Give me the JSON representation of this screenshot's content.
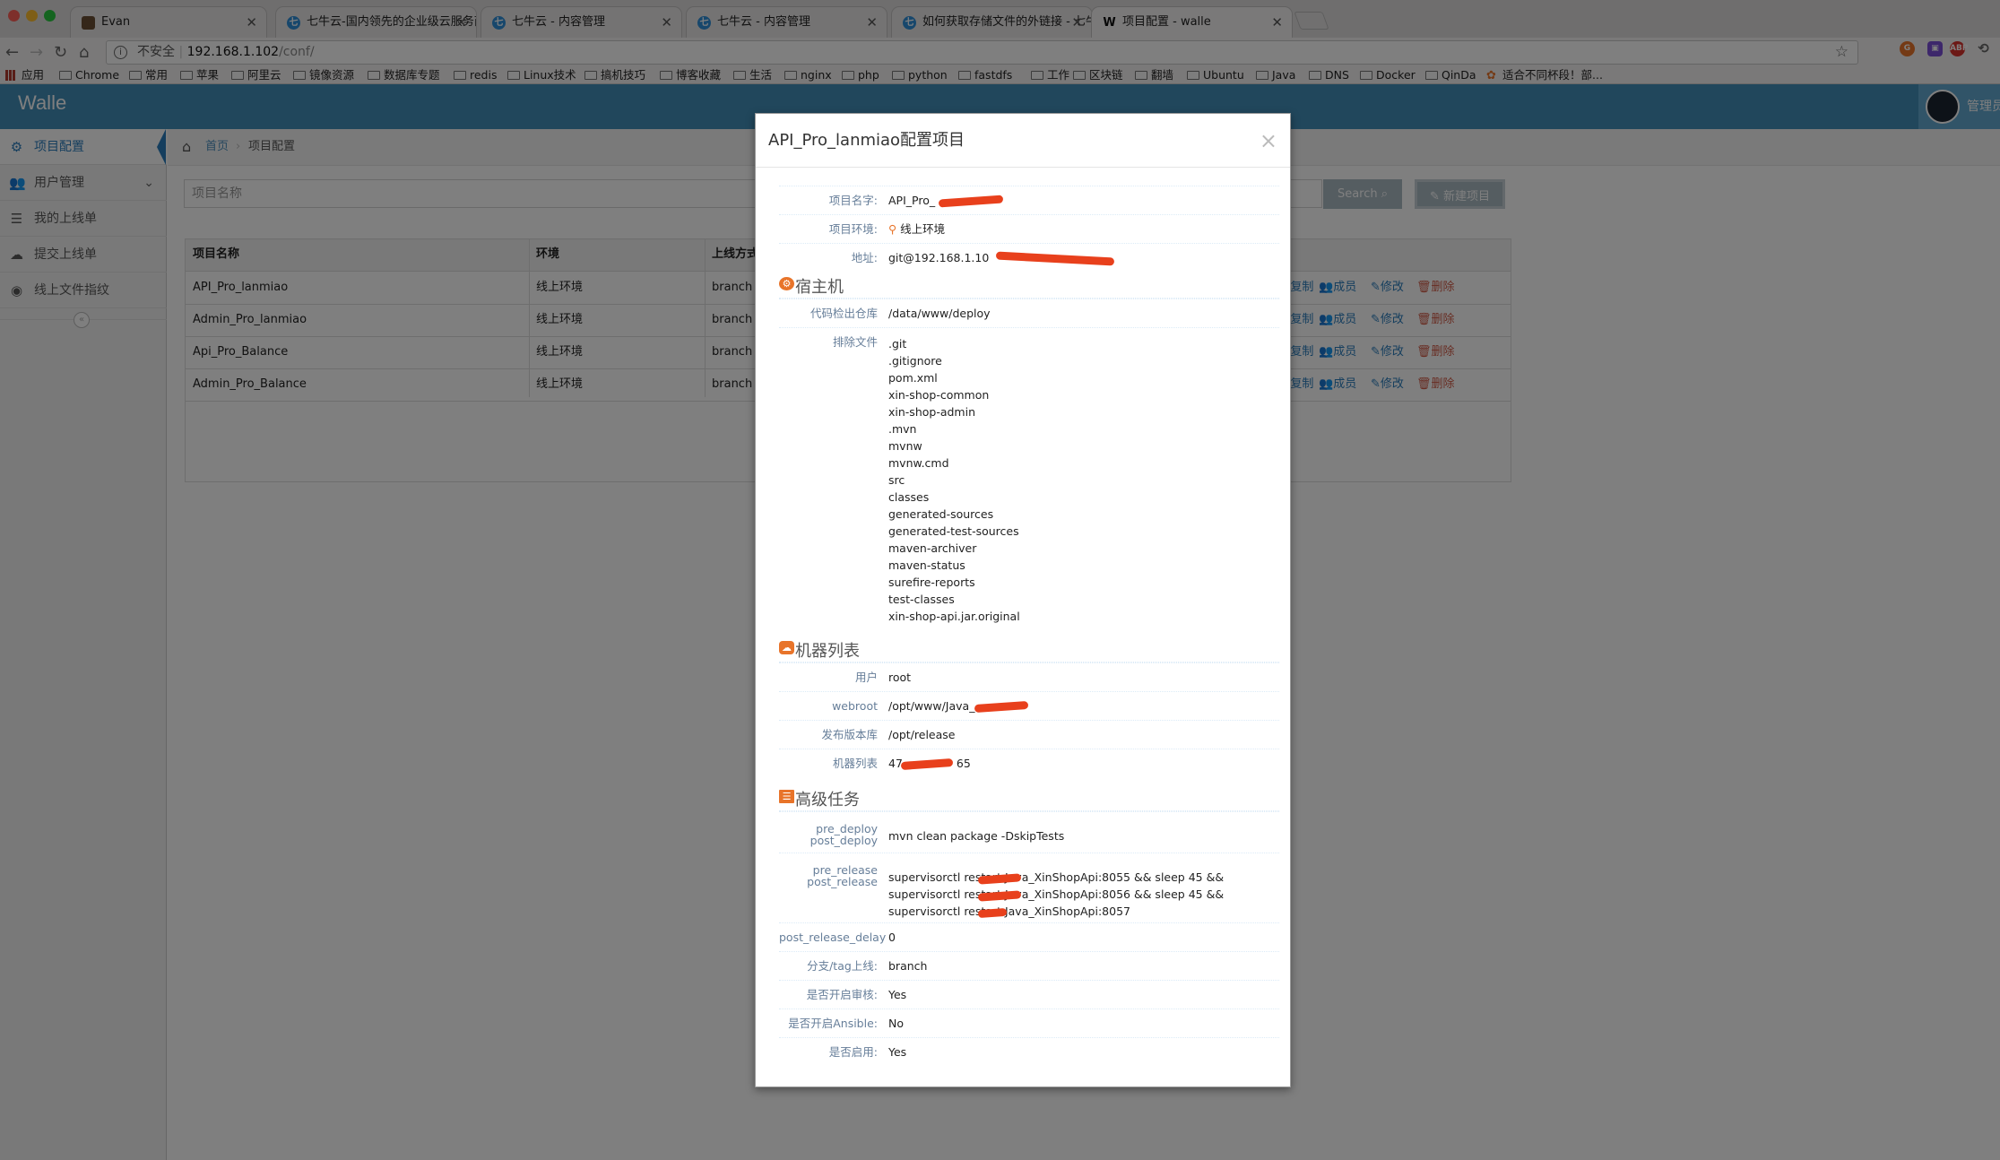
{
  "browser": {
    "tabs": [
      {
        "label": "Evan"
      },
      {
        "label": "七牛云-国内领先的企业级云服务商"
      },
      {
        "label": "七牛云 - 内容管理"
      },
      {
        "label": "七牛云 - 内容管理"
      },
      {
        "label": "如何获取存储文件的外链接 - 七牛"
      },
      {
        "label": "项目配置 - walle"
      }
    ],
    "url": {
      "security": "不安全",
      "host": "192.168.1.102",
      "path": "/conf/"
    },
    "bookmarks": [
      "应用",
      "Chrome",
      "常用",
      "苹果",
      "阿里云",
      "镜像资源",
      "数据库专题",
      "redis",
      "Linux技术",
      "搞机技巧",
      "博客收藏",
      "生活",
      "nginx",
      "php",
      "python",
      "fastdfs",
      "工作",
      "区块链",
      "翻墙",
      "Ubuntu",
      "Java",
      "DNS",
      "Docker",
      "QinDa",
      "适合不同杯段！部..."
    ]
  },
  "app": {
    "brand": "Walle",
    "user_name": "管理员",
    "sidebar": [
      {
        "label": "项目配置",
        "icon": "gears-icon"
      },
      {
        "label": "用户管理",
        "icon": "users-icon"
      },
      {
        "label": "我的上线单",
        "icon": "list-icon"
      },
      {
        "label": "提交上线单",
        "icon": "cloud-upload-icon"
      },
      {
        "label": "线上文件指纹",
        "icon": "eye-icon"
      }
    ],
    "breadcrumb": {
      "home": "首页",
      "current": "项目配置"
    },
    "search": {
      "placeholder": "项目名称",
      "button": "Search",
      "new_button": "新建项目"
    },
    "table": {
      "headers": [
        "项目名称",
        "环境",
        "上线方式"
      ],
      "rows": [
        {
          "name": "API_Pro_lanmiao",
          "env": "线上环境",
          "mode": "branch"
        },
        {
          "name": "Admin_Pro_lanmiao",
          "env": "线上环境",
          "mode": "branch"
        },
        {
          "name": "Api_Pro_Balance",
          "env": "线上环境",
          "mode": "branch"
        },
        {
          "name": "Admin_Pro_Balance",
          "env": "线上环境",
          "mode": "branch"
        }
      ],
      "actions": {
        "copy": "复制",
        "members": "成员",
        "edit": "修改",
        "delete": "删除"
      }
    }
  },
  "modal": {
    "title": "API_Pro_lanmiao配置项目",
    "close": "×",
    "project_name_label": "项目名字:",
    "project_name_value": "API_Pro_",
    "env_label": "项目环境:",
    "env_value": "线上环境",
    "repo_label": "地址:",
    "repo_value": "git@192.168.1.10",
    "host_section": "宿主机",
    "checkout_label": "代码检出仓库",
    "checkout_value": "/data/www/deploy",
    "exclude_label": "排除文件",
    "excludes": [
      ".git",
      ".gitignore",
      "pom.xml",
      "xin-shop-common",
      "xin-shop-admin",
      ".mvn",
      "mvnw",
      "mvnw.cmd",
      "src",
      "classes",
      "generated-sources",
      "generated-test-sources",
      "maven-archiver",
      "maven-status",
      "surefire-reports",
      "test-classes",
      "xin-shop-api.jar.original"
    ],
    "machine_section": "机器列表",
    "user_label": "用户",
    "user_value": "root",
    "webroot_label": "webroot",
    "webroot_value": "/opt/www/Java_",
    "release_label": "发布版本库",
    "release_value": "/opt/release",
    "hosts_label": "机器列表",
    "hosts_value_prefix": "47",
    "hosts_value_suffix": "65",
    "advanced_section": "高级任务",
    "pre_deploy_label": "pre_deploy",
    "post_deploy_label": "post_deploy",
    "post_deploy_value": "mvn clean package -DskipTests",
    "pre_release_label": "pre_release",
    "post_release_label": "post_release",
    "post_release_lines": [
      "supervisorctl restart Java_XinShopApi:8055 && sleep 45 &&",
      "supervisorctl restart Java_XinShopApi:8056 && sleep 45 &&",
      "supervisorctl restart Java_XinShopApi:8057"
    ],
    "delay_label": "post_release_delay",
    "delay_value": "0",
    "branch_label": "分支/tag上线:",
    "branch_value": "branch",
    "audit_label": "是否开启审核:",
    "audit_value": "Yes",
    "ansible_label": "是否开启Ansible:",
    "ansible_value": "No",
    "enabled_label": "是否启用:",
    "enabled_value": "Yes"
  },
  "colors": {
    "navbar": "#438eb9",
    "link": "#2b7dbc",
    "delete": "#d15b47",
    "overlay": "rgba(0,0,0,0.5)",
    "redaction": "#e8401c"
  }
}
